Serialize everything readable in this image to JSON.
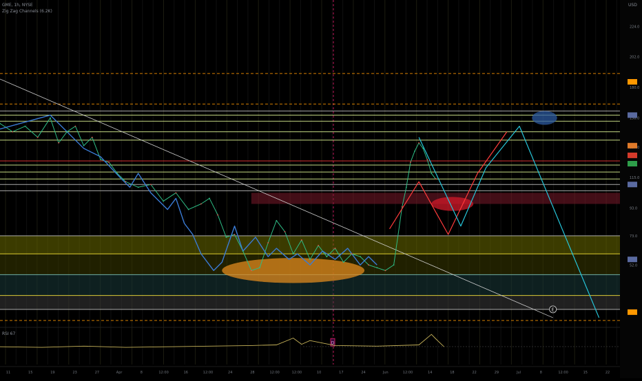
{
  "header": {
    "symbol": "GME, 1h, NYSE",
    "indicator": "Zig Zag Channels (6.2K)"
  },
  "currency": "USD",
  "lower_pane_label": "RSI 67",
  "chart_data": {
    "type": "line",
    "title": "",
    "xlabel": "",
    "ylabel": "",
    "ylim": [
      10,
      240
    ],
    "price_scale_ticks": [
      {
        "value": 224.0,
        "label": "224.0"
      },
      {
        "value": 202.0,
        "label": "202.0"
      },
      {
        "value": 180.0,
        "label": "180.0"
      },
      {
        "value": 158.0,
        "label": "158.0"
      },
      {
        "value": 137.0,
        "label": "137.0"
      },
      {
        "value": 115.0,
        "label": "115.0"
      },
      {
        "value": 93.0,
        "label": "93.0"
      },
      {
        "value": 73.0,
        "label": "73.0"
      },
      {
        "value": 52.0,
        "label": "52.0"
      }
    ],
    "x_ticks": [
      "11",
      "15",
      "19",
      "23",
      "27",
      "Apr",
      "8",
      "12:00",
      "16",
      "12:00",
      "24",
      "28",
      "12:00",
      "12:00",
      "10",
      "17",
      "24",
      "Jun",
      "12:00",
      "14",
      "18",
      "22",
      "29",
      "Jul",
      "8",
      "12:00",
      "15",
      "22"
    ],
    "price_series": {
      "name": "GME",
      "t": [
        0,
        3,
        6,
        9,
        12,
        14,
        16,
        18,
        20,
        22,
        24,
        26,
        28,
        30,
        33,
        36,
        39,
        42,
        45,
        48,
        50,
        52,
        54,
        56,
        58,
        60,
        62,
        64,
        66,
        68,
        70,
        72,
        74,
        76,
        78,
        80,
        82,
        84,
        86,
        88,
        90,
        92,
        94,
        96,
        97,
        98,
        99,
        100,
        101,
        102,
        103,
        104
      ],
      "values": [
        154,
        148,
        152,
        144,
        158,
        140,
        148,
        152,
        138,
        144,
        128,
        126,
        118,
        112,
        108,
        110,
        98,
        104,
        92,
        96,
        100,
        88,
        72,
        74,
        62,
        48,
        50,
        68,
        84,
        76,
        60,
        70,
        56,
        66,
        58,
        64,
        54,
        60,
        58,
        52,
        50,
        48,
        52,
        94,
        108,
        126,
        134,
        140,
        136,
        128,
        118,
        114
      ]
    },
    "zigzag_series": {
      "name": "",
      "t": [
        0,
        12,
        20,
        24,
        29,
        31,
        33,
        36,
        38,
        40,
        42,
        44,
        46,
        48,
        51,
        53,
        56,
        58,
        61,
        64,
        66,
        69,
        71,
        74,
        77,
        80,
        83,
        86,
        88,
        90
      ],
      "values": [
        150,
        160,
        136,
        130,
        114,
        108,
        118,
        104,
        98,
        92,
        100,
        82,
        74,
        60,
        48,
        54,
        80,
        62,
        72,
        58,
        64,
        56,
        60,
        52,
        62,
        56,
        64,
        52,
        58,
        52
      ]
    },
    "projection_red": {
      "t": [
        93,
        100,
        107,
        114,
        121
      ],
      "values": [
        78,
        112,
        74,
        118,
        148
      ]
    },
    "projection_cyan": {
      "t": [
        100,
        110,
        116,
        124,
        143
      ],
      "values": [
        144,
        80,
        122,
        152,
        14
      ]
    },
    "trendline": {
      "t": [
        0,
        132
      ],
      "values": [
        186,
        14
      ]
    },
    "horizontal_levels": [
      {
        "value": 190.0,
        "label": "",
        "style": "dashed",
        "color": "#ff9800"
      },
      {
        "value": 168.0,
        "label": "",
        "style": "dashed",
        "color": "#ff9800"
      },
      {
        "value": 163.0,
        "label": "",
        "style": "solid",
        "color": "#c7c7c7"
      },
      {
        "value": 160.0,
        "label": "",
        "style": "solid",
        "color": "#e8ff9a"
      },
      {
        "value": 155.6,
        "label": "",
        "style": "solid",
        "color": "#e8ff9a"
      },
      {
        "value": 148.0,
        "label": "",
        "style": "solid",
        "color": "#e8ff9a"
      },
      {
        "value": 142.0,
        "label": "",
        "style": "solid",
        "color": "#e8ff9a"
      },
      {
        "value": 127.0,
        "label": "",
        "style": "solid",
        "color": "#ff3b3b"
      },
      {
        "value": 124.0,
        "label": "",
        "style": "solid",
        "color": "#e8ff9a"
      },
      {
        "value": 119.0,
        "label": "",
        "style": "solid",
        "color": "#e8ff9a"
      },
      {
        "value": 114.0,
        "label": "",
        "style": "solid",
        "color": "#e8ff9a"
      },
      {
        "value": 110.0,
        "label": "",
        "style": "solid",
        "color": "#c7c7c7"
      },
      {
        "value": 105.5,
        "label": "",
        "style": "solid",
        "color": "#c7c7c7"
      },
      {
        "value": 73.0,
        "label": "",
        "style": "solid",
        "color": "#c7c7c7"
      },
      {
        "value": 60.0,
        "label": "",
        "style": "solid",
        "color": "#ffeb3b"
      },
      {
        "value": 45.0,
        "label": "",
        "style": "solid",
        "color": "#80cbc4"
      },
      {
        "value": 30.0,
        "label": "",
        "style": "solid",
        "color": "#ffeb3b"
      },
      {
        "value": 20.0,
        "label": "",
        "style": "solid",
        "color": "#c7c7c7"
      },
      {
        "value": 12.0,
        "label": "",
        "style": "dashed",
        "color": "#ff9800"
      }
    ],
    "zones": [
      {
        "from": 60,
        "to": 73,
        "color": "#6b6b00"
      },
      {
        "from": 45,
        "to": 60,
        "color": "#3b3b00"
      },
      {
        "from": 30,
        "to": 45,
        "color": "#1a3a3a"
      },
      {
        "from": 20,
        "to": 30,
        "color": "#3a3a3a"
      },
      {
        "from": 96,
        "to": 104,
        "color": "#7a1a2a",
        "start_t": 60
      }
    ],
    "ellipses": [
      {
        "name": "support-ellipse",
        "t": 70,
        "value": 48,
        "rt": 17,
        "rv": 9,
        "fill": "#e08a1e"
      },
      {
        "name": "resistance-ellipse",
        "t": 108,
        "value": 96,
        "rt": 5,
        "rv": 5,
        "fill": "#d11a2a"
      },
      {
        "name": "target-circle",
        "t": 130,
        "value": 158,
        "rt": 3,
        "rv": 5,
        "fill": "#2c5aa0"
      }
    ],
    "price_tags": [
      {
        "value": 184.0,
        "color": "#ff9800"
      },
      {
        "value": 160.0,
        "color": "#5a6aa0"
      },
      {
        "value": 138.0,
        "color": "#e07a2a"
      },
      {
        "value": 131.0,
        "color": "#d43a2a"
      },
      {
        "value": 125.0,
        "color": "#2e9e4a"
      },
      {
        "value": 110.0,
        "color": "#5a6aa0"
      },
      {
        "value": 56.0,
        "color": "#5a6aa0"
      },
      {
        "value": 18.0,
        "color": "#ff9800"
      }
    ],
    "oscillator": {
      "t": [
        0,
        10,
        20,
        30,
        40,
        50,
        60,
        66,
        70,
        72,
        74,
        80,
        90,
        100,
        103,
        104,
        106
      ],
      "values": [
        0.2,
        0.1,
        0.3,
        0.1,
        0.2,
        0.3,
        0.4,
        0.5,
        1.6,
        0.6,
        1.2,
        0.4,
        0.3,
        0.5,
        2.2,
        1.5,
        0.2
      ]
    }
  },
  "colors": {
    "background": "#000000",
    "price_up": "#2ebd85",
    "zigzag": "#3a7bd5",
    "projection_red": "#ff3b3b",
    "projection_cyan": "#26c6da",
    "trendline": "#cfcfcf",
    "grid": "#141414"
  },
  "icons": {
    "e-marker": "E",
    "d-marker": "D"
  }
}
